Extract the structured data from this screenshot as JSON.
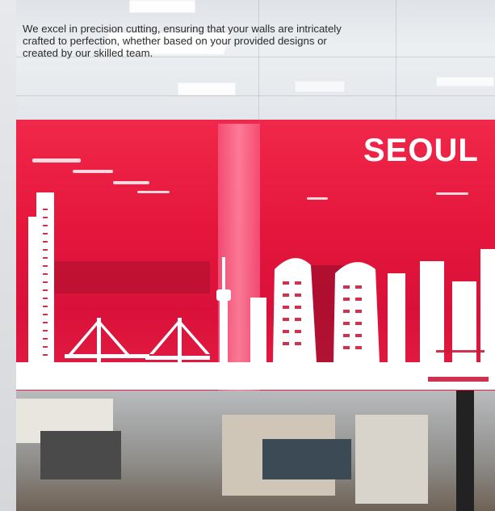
{
  "intro": {
    "line1": "We excel in precision cutting, ensuring that your walls are intricately",
    "line2": "crafted to perfection, whether based on your provided designs or",
    "line3": "created by our skilled team."
  },
  "photo": {
    "wall_text": "SEOUL",
    "colors": {
      "accent_red": "#e5163c",
      "skyline_white": "#ffffff"
    }
  }
}
